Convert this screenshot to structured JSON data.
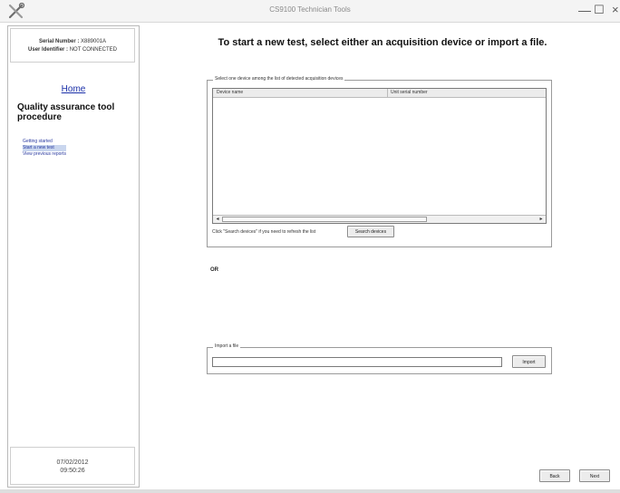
{
  "window": {
    "title": "CS9100 Technician Tools",
    "controls": {
      "minimize": "—",
      "maximize": "☐",
      "close": "×"
    }
  },
  "sidebar": {
    "serial_label": "Serial Number :",
    "serial_value": "X889001A",
    "user_label": "User Identifier :",
    "user_value": "NOT CONNECTED",
    "home_link": "Home",
    "procedure_title": "Quality assurance tool procedure",
    "steps": [
      {
        "label": "Getting started",
        "active": false
      },
      {
        "label": "Start a new test",
        "active": true
      },
      {
        "label": "View previous reports",
        "active": false
      }
    ],
    "date": "07/02/2012",
    "time": "09:50:26"
  },
  "main": {
    "heading": "To start a new test, select either an acquisition device or import a file.",
    "device_group": {
      "legend": "Select one device among the list of detected acquisition devices",
      "columns": [
        "Device name",
        "Unit serial number"
      ],
      "rows": [],
      "refresh_hint": "Click \"Search devices\" if you need to refresh the list",
      "search_button": "Search devices"
    },
    "or_label": "OR",
    "import_group": {
      "legend": "Import a file",
      "path_value": "",
      "import_button": "Import"
    }
  },
  "footer": {
    "back_button": "Back",
    "next_button": "Next"
  },
  "colors": {
    "link": "#1a2fa8",
    "active_step_bg": "#c9d6ee"
  }
}
